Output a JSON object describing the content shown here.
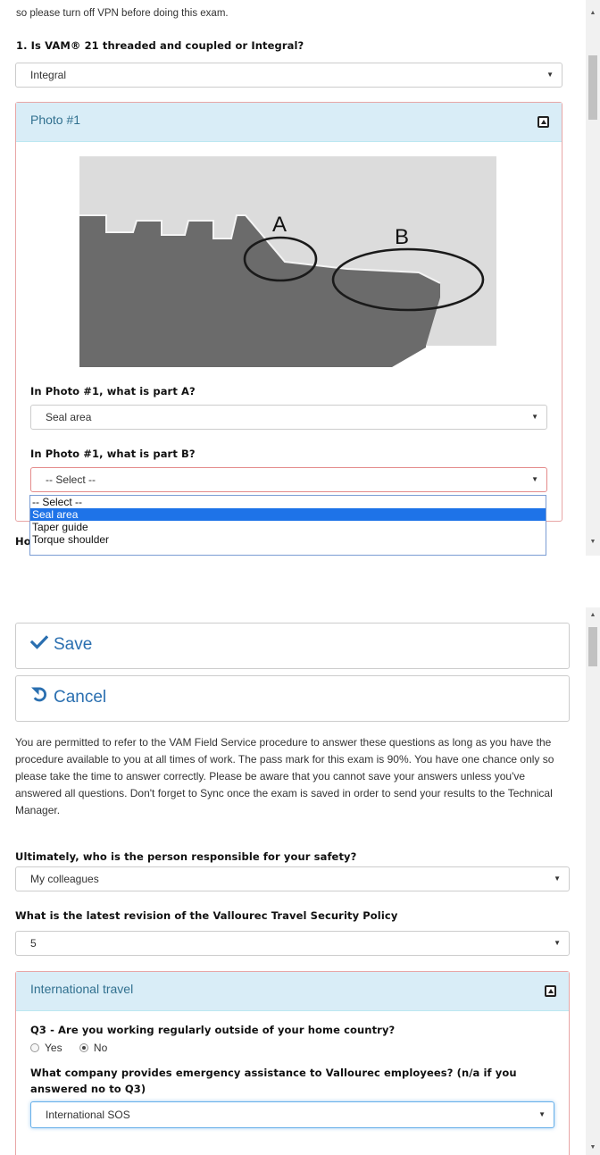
{
  "top": {
    "intro_tail": "so please turn off VPN before doing this exam.",
    "q1": {
      "label": "1. Is VAM® 21 threaded and coupled or Integral?",
      "value": "Integral"
    },
    "photo_panel": {
      "title": "Photo #1",
      "marker_a": "A",
      "marker_b": "B",
      "qa": {
        "label": "In Photo #1, what is part A?",
        "value": "Seal area"
      },
      "qb": {
        "label": "In Photo #1, what is part B?",
        "value": "-- Select --"
      }
    },
    "dropdown_options": [
      "-- Select --",
      "Seal area",
      "Taper guide",
      "Torque shoulder"
    ],
    "dropdown_selected_index": 1,
    "cut_text": "Ho"
  },
  "bottom": {
    "save_label": "Save",
    "cancel_label": "Cancel",
    "instructions": "You are permitted to refer to the VAM Field Service procedure to answer these questions as long as you have the procedure available to you at all times of work. The pass mark for this exam is 90%. You have one chance only so please take the time to answer correctly. Please be aware that you cannot save your answers unless you've answered all questions. Don't forget to Sync once the exam is saved in order to send your results to the Technical Manager.",
    "q_safety": {
      "label": "Ultimately, who is the person responsible for your safety?",
      "value": "My colleagues"
    },
    "q_policy": {
      "label": "What is the latest revision of the Vallourec Travel Security Policy",
      "value": "5"
    },
    "travel_panel": {
      "title": "International travel",
      "q3": {
        "label": "Q3 - Are you working regularly outside of your home country?",
        "yes": "Yes",
        "no": "No",
        "selected": "No"
      },
      "q_assist": {
        "label": "What company provides emergency assistance to Vallourec employees? (n/a if you answered no to Q3)",
        "value": "International SOS"
      }
    }
  },
  "icons": {
    "save": "check-icon",
    "cancel": "undo-icon",
    "collapse": "collapse-up-icon",
    "select_caret": "caret-down-icon"
  },
  "colors": {
    "panel_header_bg": "#d9edf7",
    "panel_header_text": "#31708f",
    "panel_border_error": "#e8a6a6",
    "button_text": "#2a6fb0",
    "dropdown_highlight": "#1e73e8"
  }
}
